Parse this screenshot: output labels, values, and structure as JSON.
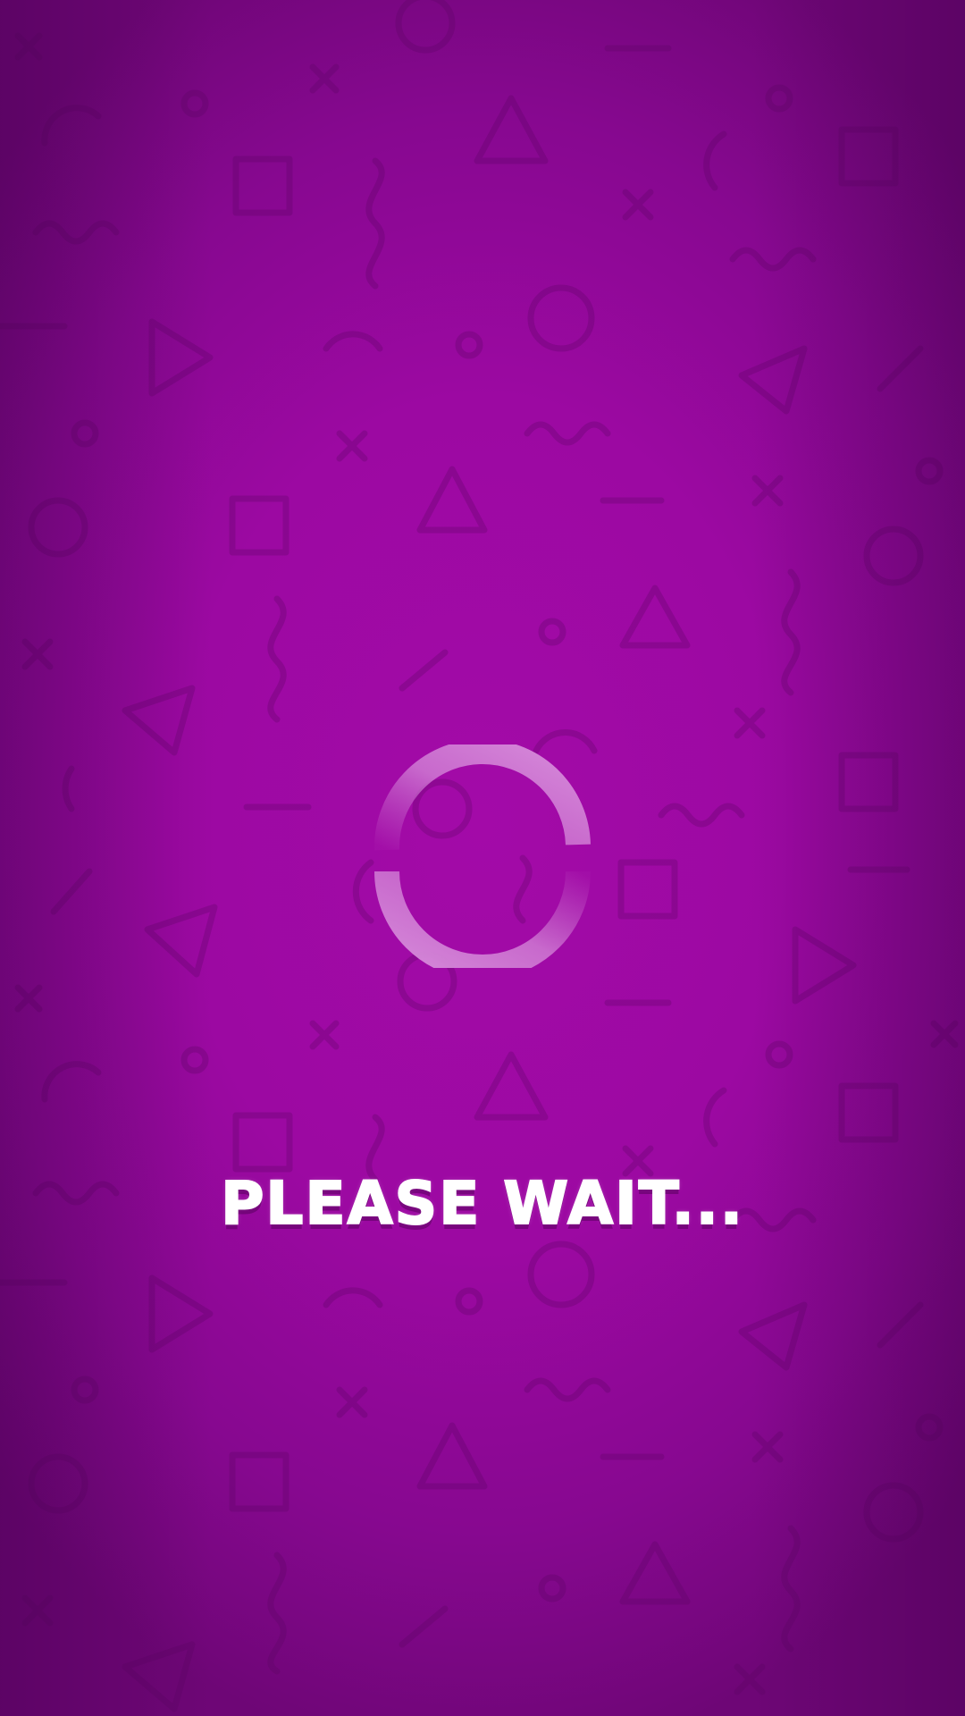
{
  "screen": {
    "name": "loading-screen",
    "background_color": "#9c09a2",
    "pattern_color": "#6a0570"
  },
  "loader": {
    "icon": "loading-spinner-icon",
    "color": "#d27fd6"
  },
  "status": {
    "message": "PLEASE WAIT..."
  }
}
